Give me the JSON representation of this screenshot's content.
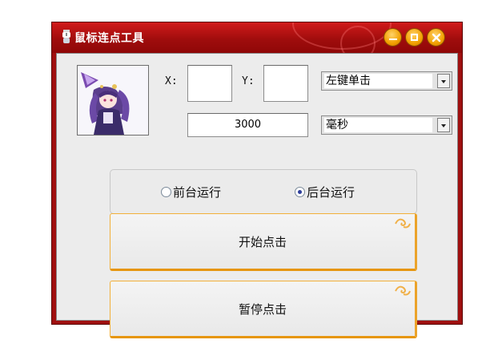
{
  "window": {
    "title": "鼠标连点工具"
  },
  "coords": {
    "x_label": "X:",
    "y_label": "Y:",
    "x_value": "",
    "y_value": ""
  },
  "click_type": {
    "selected": "左键单击"
  },
  "interval": {
    "value": "3000",
    "unit": "毫秒"
  },
  "run_mode": {
    "options": [
      {
        "label": "前台运行",
        "checked": false
      },
      {
        "label": "后台运行",
        "checked": true
      }
    ]
  },
  "buttons": {
    "start": "开始点击",
    "pause": "暂停点击"
  },
  "colors": {
    "title_red": "#a00d0d",
    "accent_orange": "#f2a000",
    "radio_dot": "#2d3e9a"
  },
  "icons": [
    "app-icon",
    "minimize-icon",
    "maximize-icon",
    "close-icon",
    "avatar-image",
    "swirl-ornament-icon"
  ]
}
